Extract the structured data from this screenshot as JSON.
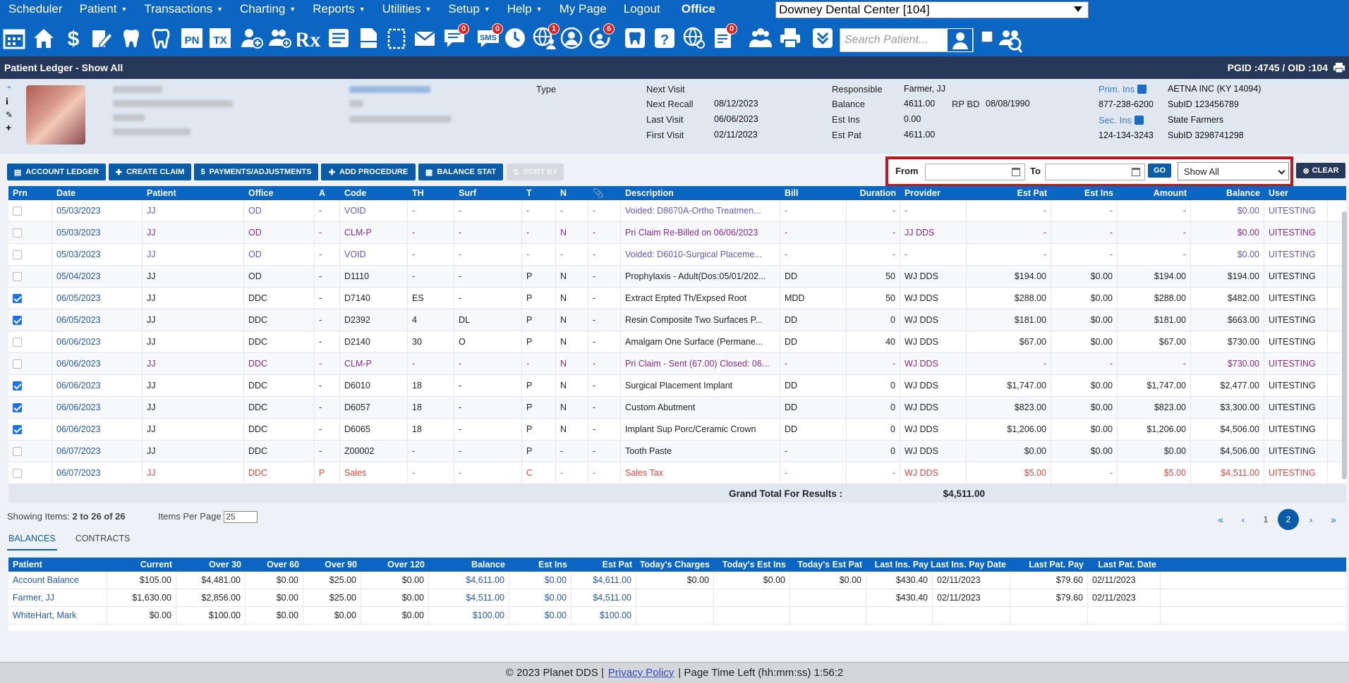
{
  "menu": [
    "Scheduler",
    "Patient",
    "Transactions",
    "Charting",
    "Reports",
    "Utilities",
    "Setup",
    "Help",
    "My Page",
    "Logout"
  ],
  "menu_caret": [
    false,
    true,
    true,
    true,
    true,
    true,
    true,
    true,
    false,
    false
  ],
  "office_label": "Office",
  "office_value": "Downey Dental Center [104]",
  "toolbar_badges": {
    "messages": "0",
    "sms": "0",
    "globe_user": "1",
    "recall": "6",
    "doc_alert": "0"
  },
  "toolbar_labels": {
    "pn": "PN",
    "tx": "TX",
    "rx": "Rx",
    "sms": "SMS"
  },
  "search_placeholder": "Search Patient...",
  "title": "Patient Ledger - Show All",
  "ids": "PGID :4745  /  OID :104",
  "patinfo": {
    "type_label": "Type",
    "next_visit_label": "Next Visit",
    "next_visit": "",
    "next_recall_label": "Next Recall",
    "next_recall": "08/12/2023",
    "last_visit_label": "Last Visit",
    "last_visit": "06/06/2023",
    "first_visit_label": "First Visit",
    "first_visit": "02/11/2023",
    "responsible_label": "Responsible",
    "responsible": "Farmer, JJ",
    "balance_label": "Balance",
    "balance": "4611.00",
    "rpbd_label": "RP BD",
    "rpbd": "08/08/1990",
    "est_ins_label": "Est Ins",
    "est_ins": "0.00",
    "est_pat_label": "Est Pat",
    "est_pat": "4611.00",
    "prim_ins_label": "Prim. Ins",
    "prim_ins": "AETNA INC (KY 14094)",
    "prim_phone": "877-238-6200",
    "prim_subid_label": "SubID",
    "prim_subid": "123456789",
    "sec_ins_label": "Sec. Ins",
    "sec_ins": "State Farmers",
    "sec_phone": "124-134-3243",
    "sec_subid_label": "SubID",
    "sec_subid": "3298741298"
  },
  "actions": [
    "ACCOUNT LEDGER",
    "CREATE CLAIM",
    "PAYMENTS/ADJUSTMENTS",
    "ADD PROCEDURE",
    "BALANCE STAT",
    "SORT BY"
  ],
  "filter": {
    "from_label": "From",
    "to_label": "To",
    "from_value": "",
    "to_value": "",
    "go": "GO",
    "show": "Show All",
    "clear": "CLEAR"
  },
  "ledger": {
    "headers": [
      "Prn",
      "Date",
      "Patient",
      "Office",
      "A",
      "Code",
      "TH",
      "Surf",
      "T",
      "N",
      "📎",
      "Description",
      "Bill",
      "Duration",
      "Provider",
      "Est Pat",
      "Est Ins",
      "Amount",
      "Balance",
      "User"
    ],
    "rows": [
      {
        "style": "void",
        "chk": false,
        "c": [
          "05/03/2023",
          "JJ",
          "OD",
          "-",
          "VOID",
          "-",
          "-",
          "-",
          "-",
          "-",
          "Voided: D8670A-Ortho Treatmen...",
          "-",
          "-",
          "-",
          "-",
          "-",
          "-",
          "$0.00",
          "UITESTING"
        ]
      },
      {
        "style": "purple",
        "chk": false,
        "c": [
          "05/03/2023",
          "JJ",
          "OD",
          "-",
          "CLM-P",
          "-",
          "-",
          "-",
          "N",
          "-",
          "Pri Claim Re-Billed on 06/06/2023",
          "-",
          "-",
          "JJ DDS",
          "-",
          "-",
          "-",
          "$0.00",
          "UITESTING"
        ]
      },
      {
        "style": "void",
        "chk": false,
        "c": [
          "05/03/2023",
          "JJ",
          "OD",
          "-",
          "VOID",
          "-",
          "-",
          "-",
          "-",
          "-",
          "Voided: D6010-Surgical Placeme...",
          "-",
          "-",
          "-",
          "-",
          "-",
          "-",
          "$0.00",
          "UITESTING"
        ]
      },
      {
        "style": "normal",
        "chk": false,
        "c": [
          "05/04/2023",
          "JJ",
          "OD",
          "-",
          "D1110",
          "-",
          "-",
          "P",
          "N",
          "-",
          "Prophylaxis - Adult(Dos:05/01/202...",
          "DD",
          "50",
          "WJ DDS",
          "$194.00",
          "$0.00",
          "$194.00",
          "$194.00",
          "UITESTING"
        ]
      },
      {
        "style": "normal",
        "chk": true,
        "c": [
          "06/05/2023",
          "JJ",
          "DDC",
          "-",
          "D7140",
          "ES",
          "-",
          "P",
          "N",
          "-",
          "Extract Erpted Th/Expsed Root",
          "MDD",
          "50",
          "WJ DDS",
          "$288.00",
          "$0.00",
          "$288.00",
          "$482.00",
          "UITESTING"
        ]
      },
      {
        "style": "normal",
        "chk": true,
        "c": [
          "06/05/2023",
          "JJ",
          "DDC",
          "-",
          "D2392",
          "4",
          "DL",
          "P",
          "N",
          "-",
          "Resin Composite Two Surfaces P...",
          "DD",
          "0",
          "WJ DDS",
          "$181.00",
          "$0.00",
          "$181.00",
          "$663.00",
          "UITESTING"
        ]
      },
      {
        "style": "normal",
        "chk": false,
        "c": [
          "06/06/2023",
          "JJ",
          "DDC",
          "-",
          "D2140",
          "30",
          "O",
          "P",
          "N",
          "-",
          "Amalgam One Surface (Permane...",
          "DD",
          "40",
          "WJ DDS",
          "$67.00",
          "$0.00",
          "$67.00",
          "$730.00",
          "UITESTING"
        ]
      },
      {
        "style": "purple",
        "chk": false,
        "c": [
          "06/06/2023",
          "JJ",
          "DDC",
          "-",
          "CLM-P",
          "-",
          "-",
          "-",
          "N",
          "-",
          "Pri Claim - Sent (67.00) Closed: 06...",
          "-",
          "-",
          "WJ DDS",
          "-",
          "-",
          "-",
          "$730.00",
          "UITESTING"
        ]
      },
      {
        "style": "normal",
        "chk": true,
        "c": [
          "06/06/2023",
          "JJ",
          "DDC",
          "-",
          "D6010",
          "18",
          "-",
          "P",
          "N",
          "-",
          "Surgical Placement Implant",
          "DD",
          "0",
          "WJ DDS",
          "$1,747.00",
          "$0.00",
          "$1,747.00",
          "$2,477.00",
          "UITESTING"
        ]
      },
      {
        "style": "normal",
        "chk": true,
        "c": [
          "06/06/2023",
          "JJ",
          "DDC",
          "-",
          "D6057",
          "18",
          "-",
          "P",
          "N",
          "-",
          "Custom Abutment",
          "DD",
          "0",
          "WJ DDS",
          "$823.00",
          "$0.00",
          "$823.00",
          "$3,300.00",
          "UITESTING"
        ]
      },
      {
        "style": "normal",
        "chk": true,
        "c": [
          "06/06/2023",
          "JJ",
          "DDC",
          "-",
          "D6065",
          "18",
          "-",
          "P",
          "N",
          "-",
          "Implant Sup Porc/Ceramic Crown",
          "DD",
          "0",
          "WJ DDS",
          "$1,206.00",
          "$0.00",
          "$1,206.00",
          "$4,506.00",
          "UITESTING"
        ]
      },
      {
        "style": "normal",
        "chk": false,
        "c": [
          "06/07/2023",
          "JJ",
          "DDC",
          "-",
          "Z00002",
          "-",
          "-",
          "P",
          "-",
          "-",
          "Tooth Paste",
          "-",
          "0",
          "WJ DDS",
          "$0.00",
          "$0.00",
          "$0.00",
          "$4,506.00",
          "UITESTING"
        ]
      },
      {
        "style": "red",
        "chk": false,
        "c": [
          "06/07/2023",
          "JJ",
          "DDC",
          "P",
          "Sales",
          "-",
          "-",
          "C",
          "-",
          "-",
          "Sales Tax",
          "-",
          "-",
          "WJ DDS",
          "$5.00",
          "-",
          "$5.00",
          "$4,511.00",
          "UITESTING"
        ]
      }
    ],
    "grand_label": "Grand Total For Results :",
    "grand_value": "$4,511.00"
  },
  "pager": {
    "showing_label": "Showing Items:",
    "showing": "2 to 26 of 26",
    "ipp_label": "Items Per Page",
    "ipp": "25",
    "first": "«",
    "prev": "‹",
    "p1": "1",
    "p2": "2",
    "next": "›",
    "last": "»"
  },
  "tabs": [
    "BALANCES",
    "CONTRACTS"
  ],
  "balances": {
    "headers": [
      "Patient",
      "Current",
      "Over 30",
      "Over 60",
      "Over 90",
      "Over 120",
      "Balance",
      "Est Ins",
      "Est Pat",
      "Today's Charges",
      "Today's Est Ins",
      "Today's Est Pat",
      "Last Ins. Pay",
      "Last Ins. Pay Date",
      "Last Pat. Pay",
      "Last Pat. Date"
    ],
    "rows": [
      [
        "Account Balance",
        "$105.00",
        "$4,481.00",
        "$0.00",
        "$25.00",
        "$0.00",
        "$4,611.00",
        "$0.00",
        "$4,611.00",
        "$0.00",
        "$0.00",
        "$0.00",
        "$430.40",
        "02/11/2023",
        "$79.60",
        "02/11/2023"
      ],
      [
        "Farmer, JJ",
        "$1,630.00",
        "$2,856.00",
        "$0.00",
        "$25.00",
        "$0.00",
        "$4,511.00",
        "$0.00",
        "$4,511.00",
        "",
        "",
        "",
        "$430.40",
        "02/11/2023",
        "$79.60",
        "02/11/2023"
      ],
      [
        "WhiteHart, Mark",
        "$0.00",
        "$100.00",
        "$0.00",
        "$0.00",
        "$0.00",
        "$100.00",
        "$0.00",
        "$100.00",
        "",
        "",
        "",
        "",
        "",
        "",
        ""
      ]
    ]
  },
  "footer": {
    "copy": "© 2023 Planet DDS |",
    "privacy": "Privacy Policy",
    "time": "| Page Time Left (hh:mm:ss) 1:56:2"
  }
}
